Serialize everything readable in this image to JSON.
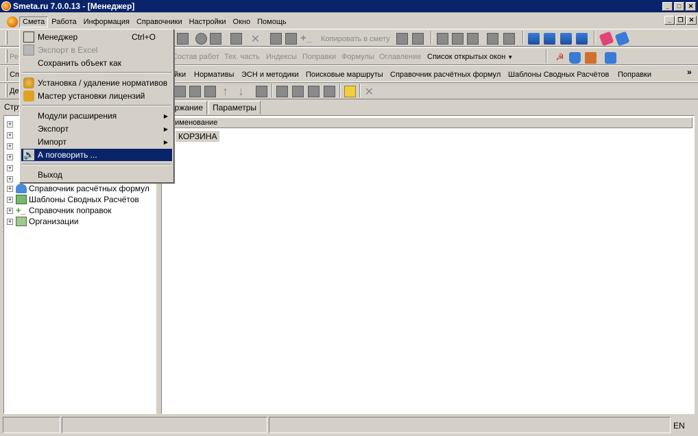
{
  "window": {
    "title": "Smeta.ru  7.0.0.13  - [Менеджер]"
  },
  "menubar": {
    "items": [
      "Смета",
      "Работа",
      "Информация",
      "Справочники",
      "Настройки",
      "Окно",
      "Помощь"
    ]
  },
  "toolbar2": {
    "copy_to_smeta": "Копировать в смету"
  },
  "toolbar3": {
    "truncated_label": "Ре",
    "items": [
      "Состав работ",
      "Тех. часть",
      "Индексы",
      "Поправки",
      "Формулы",
      "Оглавление"
    ],
    "open_windows": "Список открытых окон"
  },
  "toolbar4": {
    "truncated_label": "Сп",
    "items": [
      "йки",
      "Нормативы",
      "ЭСН и методики",
      "Поисковые маршруты",
      "Справочник расчётных формул",
      "Шаблоны Сводных Расчётов",
      "Поправки"
    ],
    "more": "»"
  },
  "toolbar5": {
    "truncated_label": "Де"
  },
  "left_panel": {
    "tab_label": "Стру",
    "tree": [
      {
        "label": "Справочник расчётных формул",
        "icon": "formula-icon"
      },
      {
        "label": "Шаблоны Сводных Расчётов",
        "icon": "template-icon"
      },
      {
        "label": "Справочник поправок",
        "icon": "corrections-icon"
      },
      {
        "label": "Организации",
        "icon": "organization-icon"
      }
    ]
  },
  "right_panel": {
    "tabs": [
      "держание",
      "Параметры"
    ],
    "column_header": "аименование",
    "row": "КОРЗИНА"
  },
  "dropdown": {
    "items": [
      {
        "label": "Менеджер",
        "shortcut": "Ctrl+O",
        "icon": "manager-icon"
      },
      {
        "label": "Экспорт в Excel",
        "icon": "excel-icon",
        "disabled": true
      },
      {
        "label": "Сохранить объект как"
      },
      {
        "label": "Установка / удаление нормативов",
        "icon": "install-icon"
      },
      {
        "label": "Мастер установки лицензий",
        "icon": "key-icon"
      },
      {
        "label": "Модули расширения",
        "submenu": true
      },
      {
        "label": "Экспорт",
        "submenu": true
      },
      {
        "label": "Импорт",
        "submenu": true
      },
      {
        "label": "А поговорить ...",
        "icon": "speaker-icon",
        "highlight": true
      },
      {
        "label": "Выход"
      }
    ]
  },
  "statusbar": {
    "lang": "EN"
  }
}
